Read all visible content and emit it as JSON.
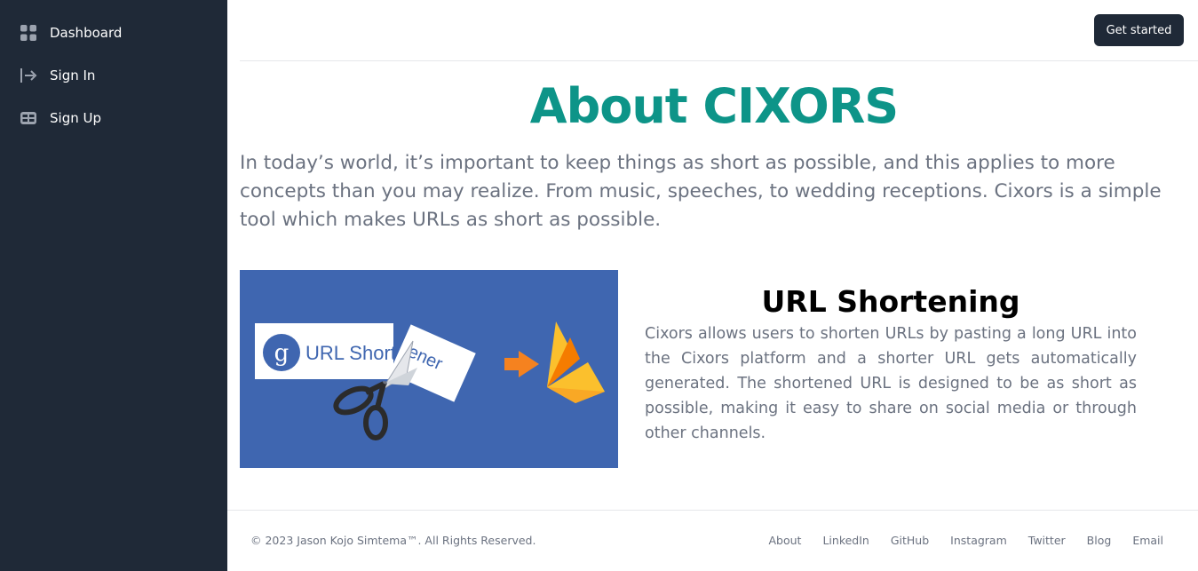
{
  "sidebar": {
    "items": [
      {
        "label": "Dashboard",
        "icon": "grid-icon"
      },
      {
        "label": "Sign In",
        "icon": "sign-in-icon"
      },
      {
        "label": "Sign Up",
        "icon": "table-icon"
      }
    ]
  },
  "header": {
    "cta_label": "Get started"
  },
  "main": {
    "title": "About CIXORS",
    "intro": "In today’s world, it’s important to keep things as short as possible, and this applies to more concepts than you may realize. From music, speeches, to wedding receptions. Cixors is a simple tool which makes URLs as short as possible.",
    "feature": {
      "title": "URL Shortening",
      "text": "Cixors allows users to shorten URLs by pasting a long URL into the Cixors platform and a shorter URL gets automatically generated. The shortened URL is designed to be as short as possible, making it easy to share on social media or through other channels.",
      "image": {
        "card_left_text": "URL Short",
        "card_right_text": "ener",
        "logo_letter": "g"
      }
    }
  },
  "footer": {
    "copyright": "© 2023 Jason Kojo Simtema™. All Rights Reserved.",
    "links": [
      "About",
      "LinkedIn",
      "GitHub",
      "Instagram",
      "Twitter",
      "Blog",
      "Email"
    ]
  },
  "colors": {
    "sidebar_bg": "#1f2937",
    "accent": "#0d9488",
    "text_muted": "#6b7280",
    "image_bg": "#3f66b0",
    "arrow": "#f5821f",
    "firebase_yellow": "#fbc02d",
    "firebase_orange": "#f57c00"
  }
}
